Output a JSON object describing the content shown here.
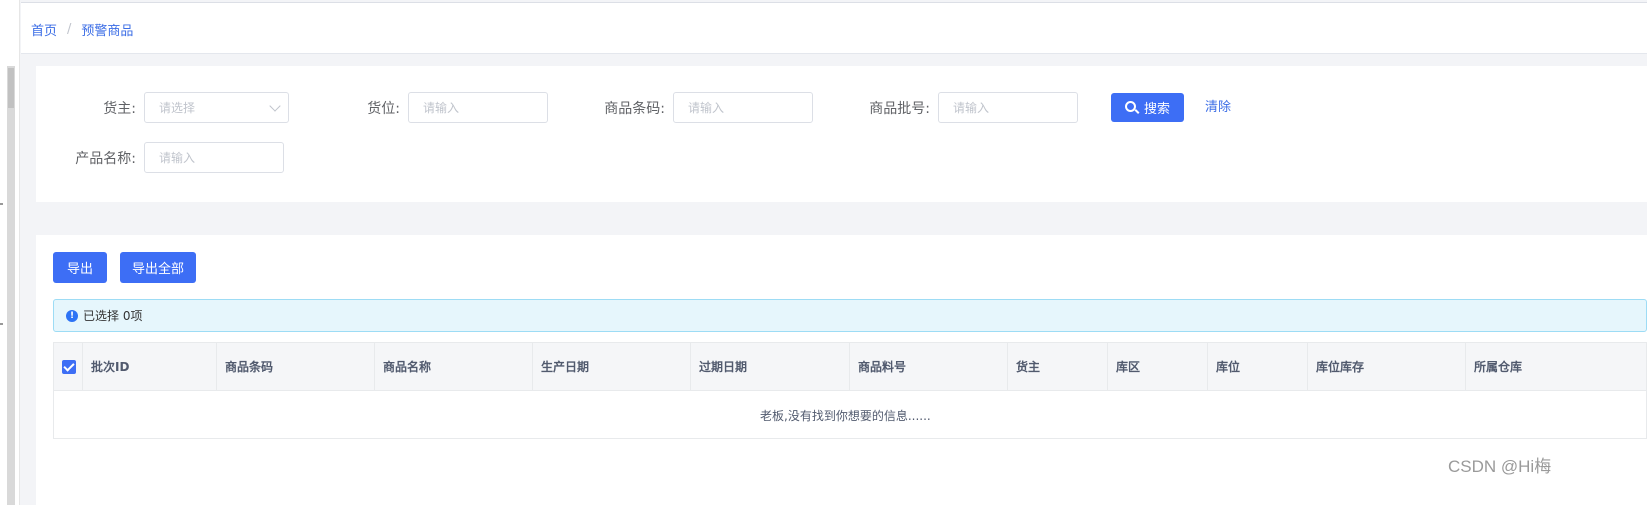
{
  "breadcrumb": {
    "home": "首页",
    "separator": "/",
    "current": "预警商品"
  },
  "search_form": {
    "owner": {
      "label": "货主:",
      "placeholder": "请选择"
    },
    "location": {
      "label": "货位:",
      "placeholder": "请输入"
    },
    "barcode": {
      "label": "商品条码:",
      "placeholder": "请输入"
    },
    "batch_no": {
      "label": "商品批号:",
      "placeholder": "请输入"
    },
    "product_name": {
      "label": "产品名称:",
      "placeholder": "请输入"
    },
    "search_button": "搜索",
    "clear_link": "清除"
  },
  "toolbar": {
    "export": "导出",
    "export_all": "导出全部"
  },
  "alert": {
    "icon": "info-icon",
    "text": "已选择 0项"
  },
  "table": {
    "columns": [
      "批次ID",
      "商品条码",
      "商品名称",
      "生产日期",
      "过期日期",
      "商品料号",
      "货主",
      "库区",
      "库位",
      "库位库存",
      "所属仓库"
    ],
    "rows": [],
    "empty_text": "老板,没有找到你想要的信息......"
  },
  "watermark": "CSDN @Hi梅",
  "colors": {
    "primary": "#3d6ef5",
    "link": "#3b6de6",
    "alert_bg": "#e6f6fc",
    "alert_border": "#9ddcf5"
  }
}
